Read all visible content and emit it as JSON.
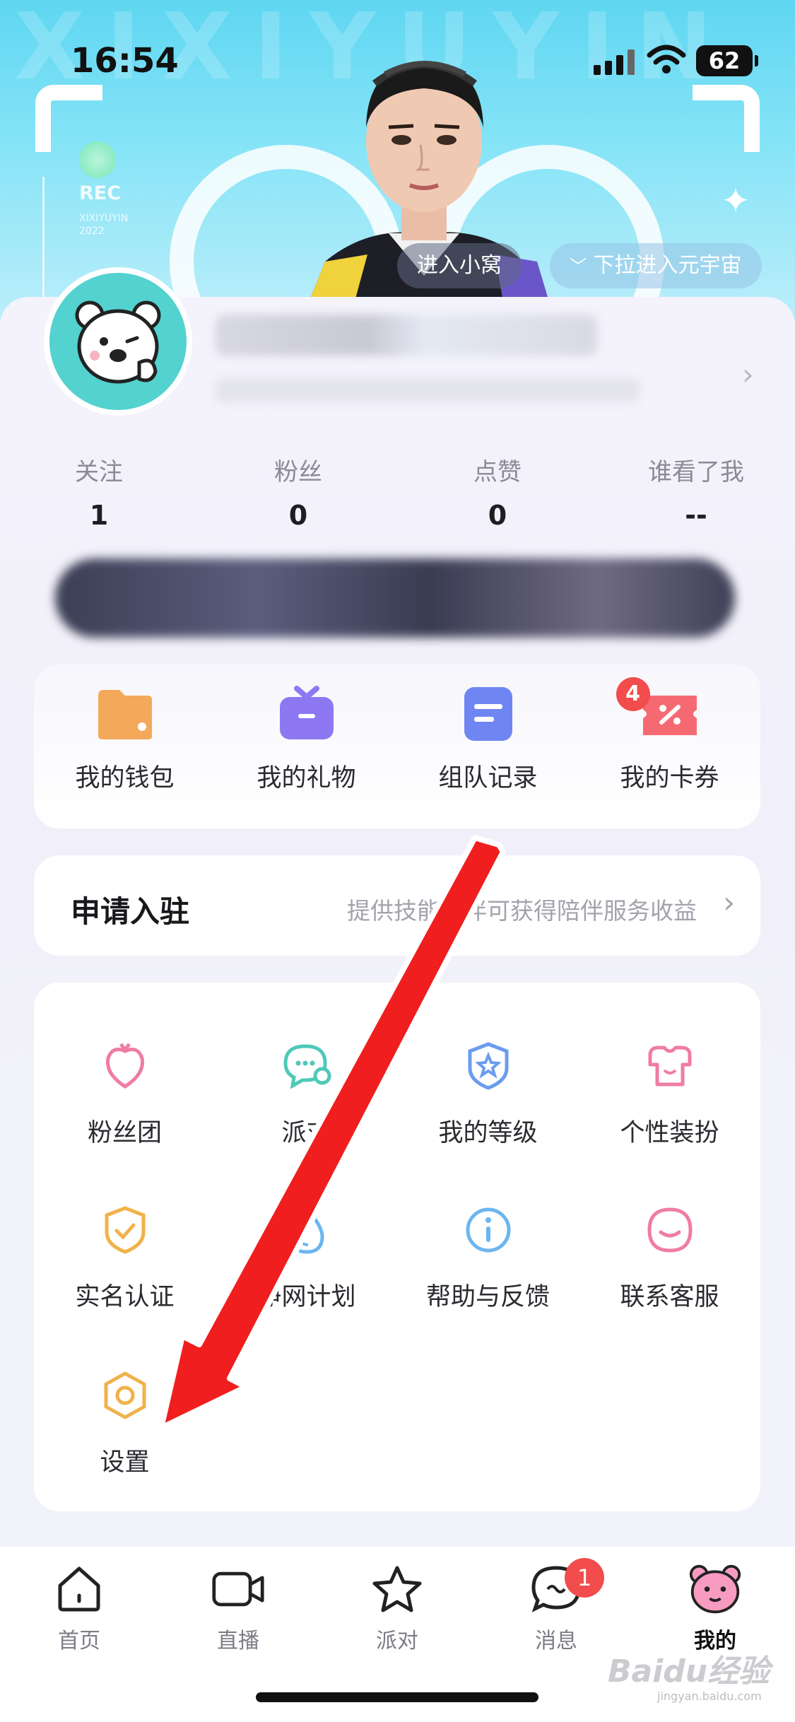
{
  "status_bar": {
    "time": "16:54",
    "battery": "62"
  },
  "hero": {
    "bg_text": "XIXIYUYIN",
    "rec_label": "REC",
    "rec_sub_1": "XIXIYUYIN",
    "rec_sub_2": "2022",
    "enter_nest_label": "进入小窝",
    "pull_down_label": "下拉进入元宇宙"
  },
  "stats": [
    {
      "label": "关注",
      "value": "1"
    },
    {
      "label": "粉丝",
      "value": "0"
    },
    {
      "label": "点赞",
      "value": "0"
    },
    {
      "label": "谁看了我",
      "value": "--"
    }
  ],
  "quick_actions": [
    {
      "label": "我的钱包",
      "icon": "wallet-icon",
      "color": "#f3a85a"
    },
    {
      "label": "我的礼物",
      "icon": "gift-icon",
      "color": "#8d78f2"
    },
    {
      "label": "组队记录",
      "icon": "team-record-icon",
      "color": "#6f86f2"
    },
    {
      "label": "我的卡券",
      "icon": "coupon-icon",
      "color": "#f56a72",
      "badge": "4"
    }
  ],
  "join": {
    "title": "申请入驻",
    "description": "提供技能陪伴可获得陪伴服务收益"
  },
  "menu": [
    {
      "label": "粉丝团",
      "icon": "fan-club-icon",
      "color": "#f07ca2"
    },
    {
      "label": "派对",
      "icon": "party-chat-icon",
      "color": "#4ec9b8"
    },
    {
      "label": "我的等级",
      "icon": "level-star-icon",
      "color": "#6b9cf0"
    },
    {
      "label": "个性装扮",
      "icon": "dress-up-icon",
      "color": "#f07ca2"
    },
    {
      "label": "实名认证",
      "icon": "shield-check-icon",
      "color": "#f0b24a"
    },
    {
      "label": "净网计划",
      "icon": "water-drop-icon",
      "color": "#6bb6f0"
    },
    {
      "label": "帮助与反馈",
      "icon": "info-icon",
      "color": "#6bb6f0"
    },
    {
      "label": "联系客服",
      "icon": "smile-service-icon",
      "color": "#f07ca2"
    },
    {
      "label": "设置",
      "icon": "settings-hexagon-icon",
      "color": "#f0b24a"
    }
  ],
  "tabs": [
    {
      "label": "首页",
      "icon": "home-icon"
    },
    {
      "label": "直播",
      "icon": "live-camera-icon"
    },
    {
      "label": "派对",
      "icon": "party-star-icon"
    },
    {
      "label": "消息",
      "icon": "message-icon",
      "badge": "1"
    },
    {
      "label": "我的",
      "icon": "bear-profile-icon",
      "active": true
    }
  ],
  "watermark": {
    "brand": "Baidu经验",
    "url": "jingyan.baidu.com"
  },
  "colors": {
    "accent_red": "#f24c4c",
    "hero_cyan": "#5fd6f2",
    "avatar_teal": "#53d2cf"
  }
}
